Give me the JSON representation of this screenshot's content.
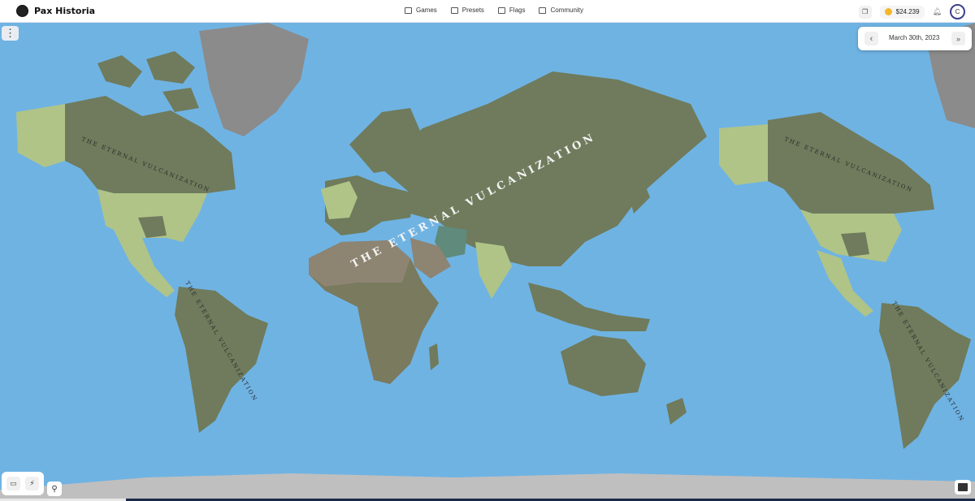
{
  "app": {
    "title": "Pax Historia",
    "logo_icon": "pax-historia-logo-icon"
  },
  "nav": [
    {
      "label": "Games",
      "icon": "gamepad-icon"
    },
    {
      "label": "Presets",
      "icon": "play-icon"
    },
    {
      "label": "Flags",
      "icon": "flag-icon"
    },
    {
      "label": "Community",
      "icon": "users-icon"
    }
  ],
  "header_right": {
    "gift_icon": "gift-icon",
    "coins": "$24.239",
    "coin_icon": "coin-icon",
    "bell_icon": "bell-icon",
    "avatar_letter": "C"
  },
  "date": {
    "text": "March 30th, 2023",
    "prev_icon": "chevron-left-icon",
    "next_icon": "fast-forward-icon"
  },
  "map": {
    "labels": [
      "THE ETERNAL VULCANIZATION",
      "THE ETERNAL VULCANIZATION",
      "THE ETERNAL VULCANIZATION",
      "THE ETERNAL VULCANIZATION",
      "THE ETERNAL VULCANIZATION"
    ],
    "colors": {
      "ocean": "#6fb3e3",
      "empire": "#6f7b5c",
      "light_territory": "#b0c488",
      "ice": "#9c9c9c",
      "desert": "#8d8472"
    }
  },
  "tools": {
    "chat_icon": "chat-icon",
    "lightning_icon": "lightning-icon",
    "search_icon": "search-icon",
    "book_icon": "book-icon",
    "menu_icon": "more-vertical-icon"
  }
}
